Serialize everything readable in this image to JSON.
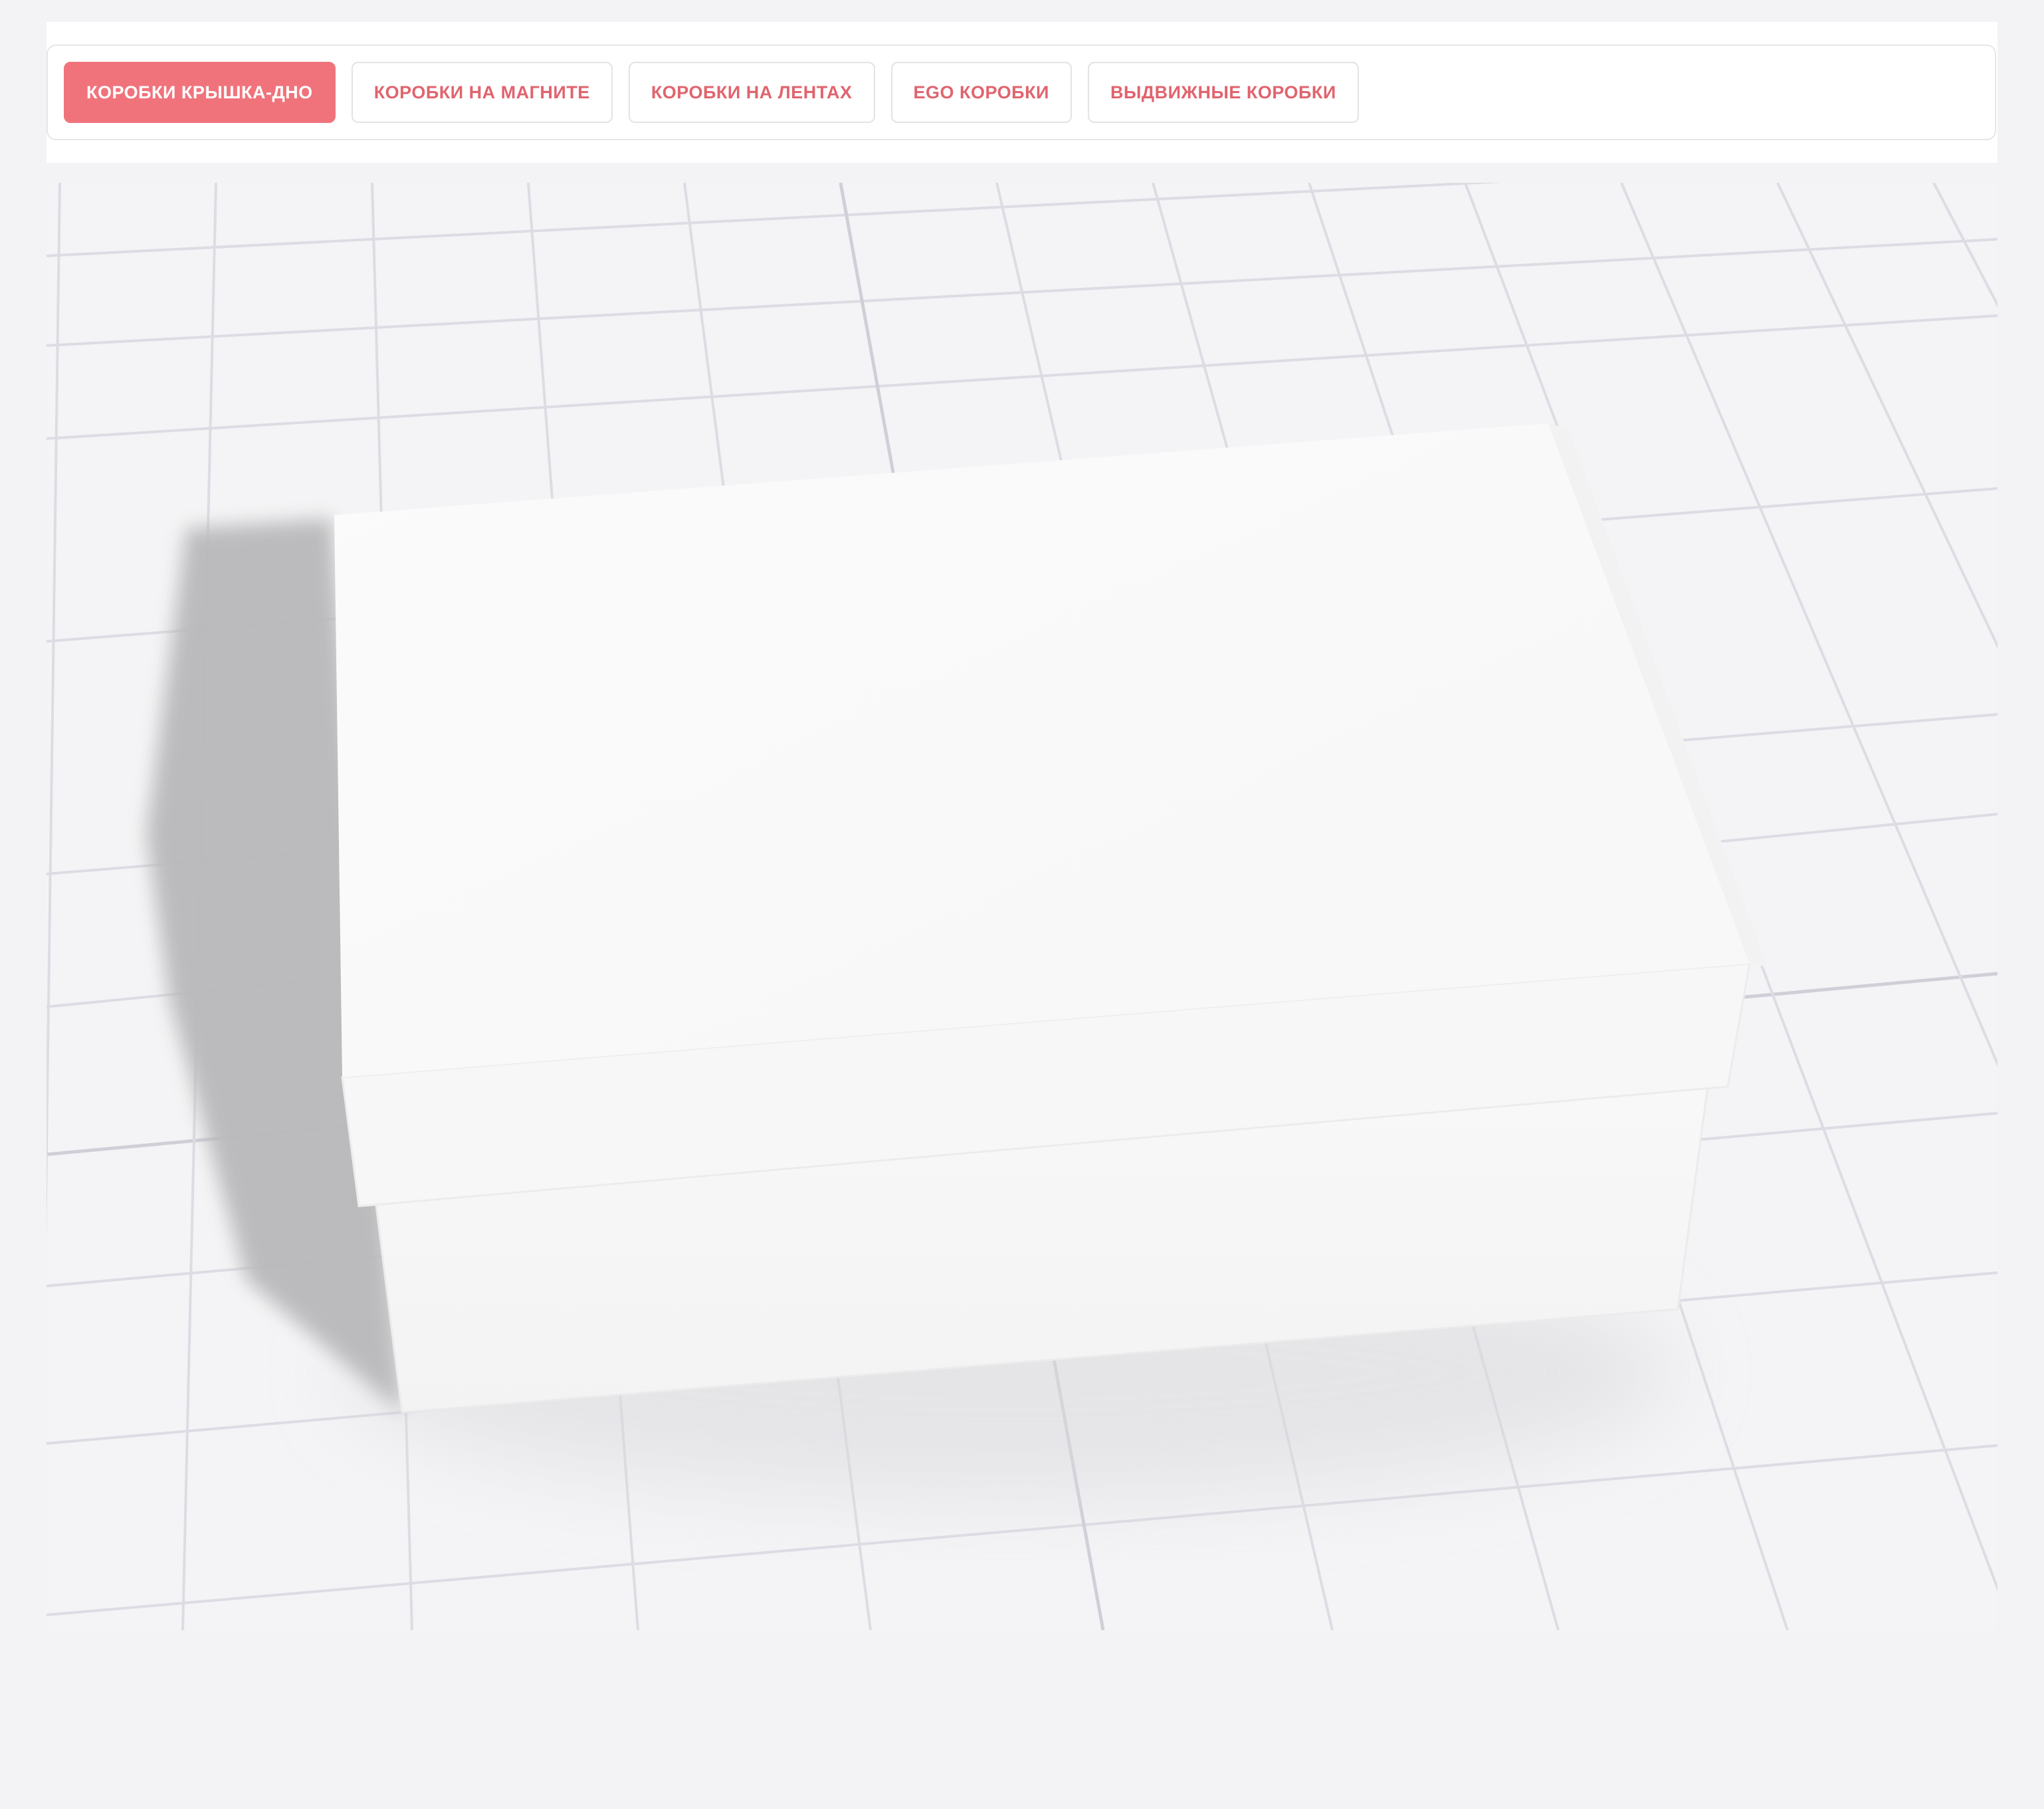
{
  "tabs": [
    {
      "label": "КОРОБКИ КРЫШКА-ДНО",
      "active": true
    },
    {
      "label": "КОРОБКИ НА МАГНИТЕ",
      "active": false
    },
    {
      "label": "КОРОБКИ НА ЛЕНТАХ",
      "active": false
    },
    {
      "label": "EGO КОРОБКИ",
      "active": false
    },
    {
      "label": "ВЫДВИЖНЫЕ КОРОБКИ",
      "active": false
    }
  ],
  "colors": {
    "accent": "#f0737c",
    "accent_text": "#e0646e",
    "page_background": "#f3f3f5",
    "grid_line": "#dcdce4"
  },
  "viewer": {
    "model": "lid-and-base box"
  }
}
